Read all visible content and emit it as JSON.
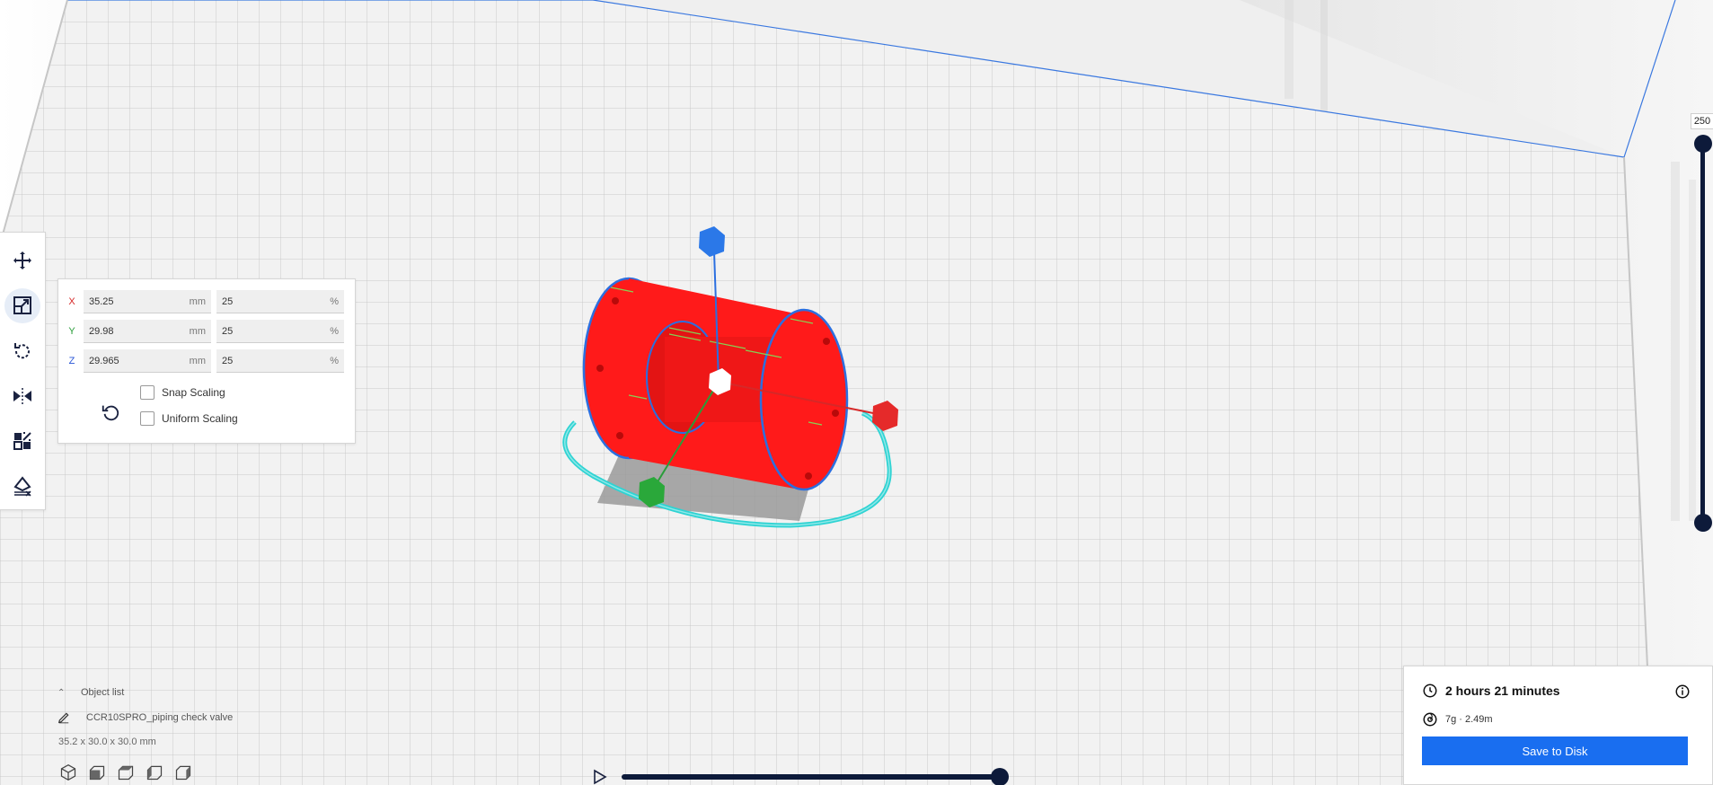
{
  "app": "Ultimaker Cura",
  "toolbar": {
    "tools": [
      {
        "id": "move",
        "icon": "move-icon"
      },
      {
        "id": "scale",
        "icon": "scale-icon",
        "active": true
      },
      {
        "id": "rotate",
        "icon": "rotate-icon"
      },
      {
        "id": "mirror",
        "icon": "mirror-icon"
      },
      {
        "id": "per-model-settings",
        "icon": "per-model-settings-icon"
      },
      {
        "id": "support-blocker",
        "icon": "support-blocker-icon"
      }
    ]
  },
  "scale_panel": {
    "x": {
      "label": "X",
      "mm": "35.25",
      "mm_unit": "mm",
      "percent": "25",
      "percent_unit": "%"
    },
    "y": {
      "label": "Y",
      "mm": "29.98",
      "mm_unit": "mm",
      "percent": "25",
      "percent_unit": "%"
    },
    "z": {
      "label": "Z",
      "mm": "29.965",
      "mm_unit": "mm",
      "percent": "25",
      "percent_unit": "%"
    },
    "snap_scaling": {
      "label": "Snap Scaling",
      "checked": false
    },
    "uniform_scaling": {
      "label": "Uniform Scaling",
      "checked": false
    },
    "reset_icon": "reset-icon"
  },
  "object_list": {
    "toggle_label": "Object list",
    "object_name": "CCR10SPRO_piping check valve",
    "dimensions": "35.2 x 30.0 x 30.0 mm",
    "view_icons": [
      "3d-view-icon",
      "front-view-icon",
      "top-view-icon",
      "left-view-icon",
      "right-view-icon"
    ]
  },
  "layer_slider": {
    "top_value": "250"
  },
  "print_info": {
    "time": "2 hours 21 minutes",
    "material": "7g · 2.49m",
    "save_label": "Save to Disk"
  },
  "colors": {
    "accent": "#196ef0",
    "slider": "#0d1a3a",
    "model": "#ff1a1a",
    "outline": "#2b6fe0",
    "axis_x": "#d62828",
    "axis_y": "#2a9d3a",
    "axis_z": "#2855d6"
  }
}
